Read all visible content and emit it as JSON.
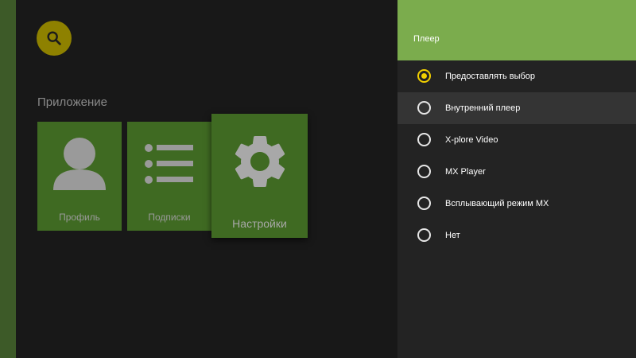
{
  "app": {
    "section_title": "Приложение",
    "cards": [
      {
        "label": "Профиль",
        "icon": "person-icon"
      },
      {
        "label": "Подписки",
        "icon": "list-icon"
      },
      {
        "label": "Настройки",
        "icon": "gear-icon"
      }
    ]
  },
  "panel": {
    "title": "Плеер",
    "options": [
      {
        "label": "Предоставлять выбор",
        "selected": true
      },
      {
        "label": "Внутренний плеер",
        "selected": false
      },
      {
        "label": "X-plore Video",
        "selected": false
      },
      {
        "label": "MX Player",
        "selected": false
      },
      {
        "label": "Всплывающий режим MX",
        "selected": false
      },
      {
        "label": "Нет",
        "selected": false
      }
    ]
  },
  "colors": {
    "accent_green": "#7bac4d",
    "card_green": "#3f6a22",
    "search_yellow": "#8e8100",
    "radio_selected": "#f2d000"
  }
}
